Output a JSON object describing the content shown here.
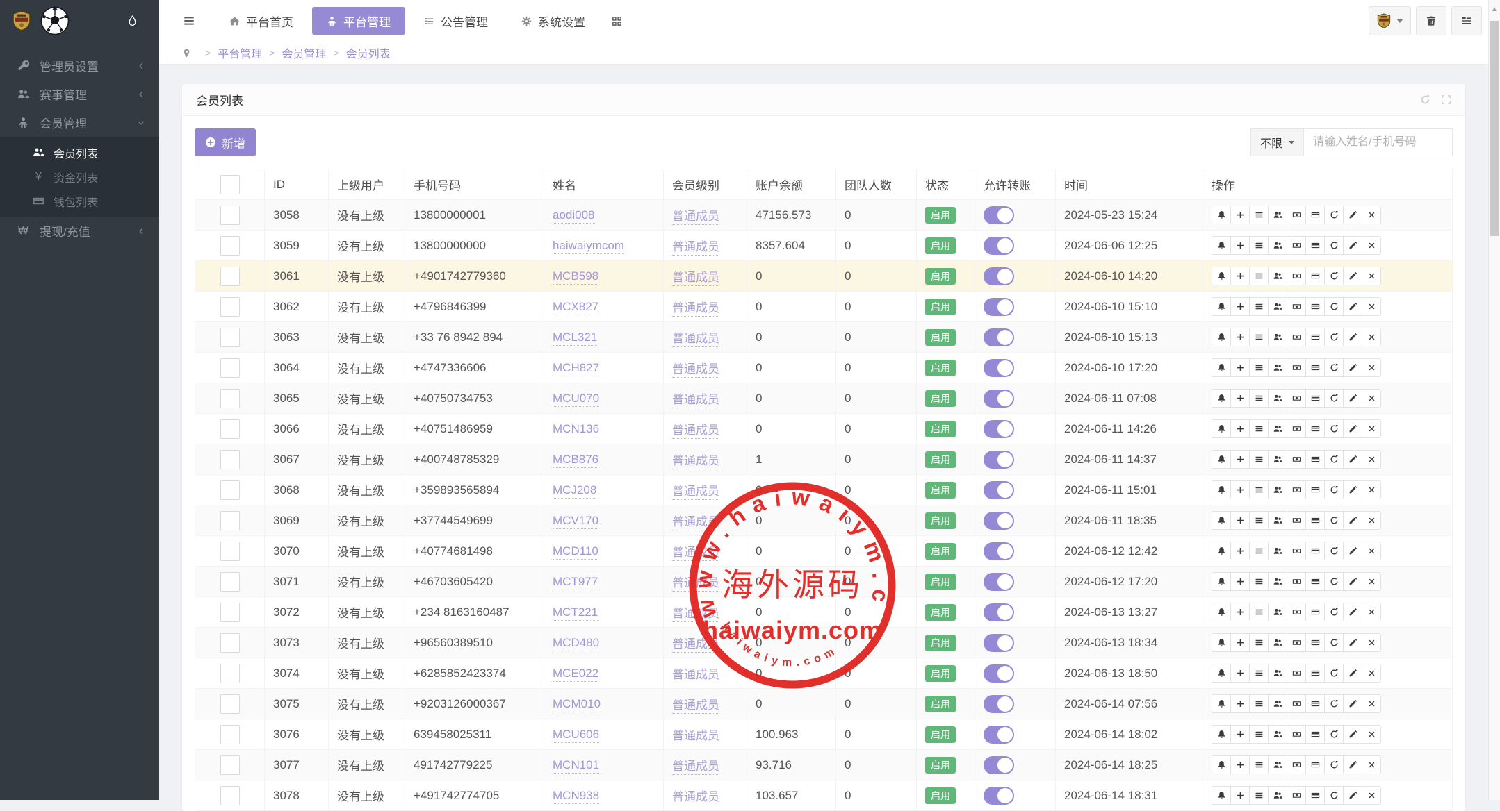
{
  "navbar": {
    "menu": [
      {
        "label": "平台首页",
        "icon": "i-home",
        "active": false
      },
      {
        "label": "平台管理",
        "icon": "i-person",
        "active": true
      },
      {
        "label": "公告管理",
        "icon": "i-list",
        "active": false
      },
      {
        "label": "系统设置",
        "icon": "i-gear",
        "active": false
      }
    ]
  },
  "sidebar": {
    "items": [
      {
        "label": "管理员设置",
        "icon": "i-key",
        "chevron": "left"
      },
      {
        "label": "赛事管理",
        "icon": "i-users",
        "chevron": "left"
      },
      {
        "label": "会员管理",
        "icon": "i-person",
        "chevron": "down",
        "open": true,
        "children": [
          {
            "label": "会员列表",
            "icon": "i-users",
            "active": true
          },
          {
            "label": "资金列表",
            "glyph": "¥"
          },
          {
            "label": "钱包列表",
            "icon": "i-card"
          }
        ]
      },
      {
        "label": "提现/充值",
        "glyph": "₩",
        "chevron": "left"
      }
    ]
  },
  "breadcrumb": {
    "sep": ">",
    "items": [
      "平台管理",
      "会员管理",
      "会员列表"
    ]
  },
  "card": {
    "title": "会员列表",
    "add_label": "新增",
    "filter_label": "不限",
    "search_placeholder": "请输入姓名/手机号码"
  },
  "table": {
    "headers": [
      "",
      "ID",
      "上级用户",
      "手机号码",
      "姓名",
      "会员级别",
      "账户余额",
      "团队人数",
      "状态",
      "允许转账",
      "时间",
      "操作"
    ],
    "status_label": "启用",
    "row_actions": [
      {
        "name": "bell-button",
        "icon": "i-bell"
      },
      {
        "name": "plus-button",
        "icon": "i-plus"
      },
      {
        "name": "detail-button",
        "icon": "i-bars"
      },
      {
        "name": "team-button",
        "icon": "i-users"
      },
      {
        "name": "money-button",
        "icon": "i-money"
      },
      {
        "name": "card-button",
        "icon": "i-card"
      },
      {
        "name": "refresh-button",
        "icon": "i-refresh"
      },
      {
        "name": "edit-button",
        "icon": "i-pencil"
      },
      {
        "name": "delete-button",
        "icon": "i-x"
      }
    ],
    "rows": [
      {
        "id": "3058",
        "parent": "没有上级",
        "phone": "13800000001",
        "name": "aodi008",
        "level": "普通成员",
        "balance": "47156.573",
        "team": "0",
        "time": "2024-05-23 15:24",
        "highlight": false
      },
      {
        "id": "3059",
        "parent": "没有上级",
        "phone": "13800000000",
        "name": "haiwaiymcom",
        "level": "普通成员",
        "balance": "8357.604",
        "team": "0",
        "time": "2024-06-06 12:25",
        "highlight": false
      },
      {
        "id": "3061",
        "parent": "没有上级",
        "phone": "+4901742779360",
        "name": "MCB598",
        "level": "普通成员",
        "balance": "0",
        "team": "0",
        "time": "2024-06-10 14:20",
        "highlight": true
      },
      {
        "id": "3062",
        "parent": "没有上级",
        "phone": "+4796846399",
        "name": "MCX827",
        "level": "普通成员",
        "balance": "0",
        "team": "0",
        "time": "2024-06-10 15:10",
        "highlight": false
      },
      {
        "id": "3063",
        "parent": "没有上级",
        "phone": "+33 76 8942 894",
        "name": "MCL321",
        "level": "普通成员",
        "balance": "0",
        "team": "0",
        "time": "2024-06-10 15:13",
        "highlight": false
      },
      {
        "id": "3064",
        "parent": "没有上级",
        "phone": "+4747336606",
        "name": "MCH827",
        "level": "普通成员",
        "balance": "0",
        "team": "0",
        "time": "2024-06-10 17:20",
        "highlight": false
      },
      {
        "id": "3065",
        "parent": "没有上级",
        "phone": "+40750734753",
        "name": "MCU070",
        "level": "普通成员",
        "balance": "0",
        "team": "0",
        "time": "2024-06-11 07:08",
        "highlight": false
      },
      {
        "id": "3066",
        "parent": "没有上级",
        "phone": "+40751486959",
        "name": "MCN136",
        "level": "普通成员",
        "balance": "0",
        "team": "0",
        "time": "2024-06-11 14:26",
        "highlight": false
      },
      {
        "id": "3067",
        "parent": "没有上级",
        "phone": "+400748785329",
        "name": "MCB876",
        "level": "普通成员",
        "balance": "1",
        "team": "0",
        "time": "2024-06-11 14:37",
        "highlight": false
      },
      {
        "id": "3068",
        "parent": "没有上级",
        "phone": "+359893565894",
        "name": "MCJ208",
        "level": "普通成员",
        "balance": "0",
        "team": "0",
        "time": "2024-06-11 15:01",
        "highlight": false
      },
      {
        "id": "3069",
        "parent": "没有上级",
        "phone": "+37744549699",
        "name": "MCV170",
        "level": "普通成员",
        "balance": "0",
        "team": "0",
        "time": "2024-06-11 18:35",
        "highlight": false
      },
      {
        "id": "3070",
        "parent": "没有上级",
        "phone": "+40774681498",
        "name": "MCD110",
        "level": "普通成员",
        "balance": "0",
        "team": "0",
        "time": "2024-06-12 12:42",
        "highlight": false
      },
      {
        "id": "3071",
        "parent": "没有上级",
        "phone": "+46703605420",
        "name": "MCT977",
        "level": "普通成员",
        "balance": "0",
        "team": "0",
        "time": "2024-06-12 17:20",
        "highlight": false
      },
      {
        "id": "3072",
        "parent": "没有上级",
        "phone": "+234 8163160487",
        "name": "MCT221",
        "level": "普通成员",
        "balance": "0",
        "team": "0",
        "time": "2024-06-13 13:27",
        "highlight": false
      },
      {
        "id": "3073",
        "parent": "没有上级",
        "phone": "+96560389510",
        "name": "MCD480",
        "level": "普通成员",
        "balance": "0",
        "team": "0",
        "time": "2024-06-13 18:34",
        "highlight": false
      },
      {
        "id": "3074",
        "parent": "没有上级",
        "phone": "+6285852423374",
        "name": "MCE022",
        "level": "普通成员",
        "balance": "0",
        "team": "0",
        "time": "2024-06-13 18:50",
        "highlight": false
      },
      {
        "id": "3075",
        "parent": "没有上级",
        "phone": "+9203126000367",
        "name": "MCM010",
        "level": "普通成员",
        "balance": "0",
        "team": "0",
        "time": "2024-06-14 07:56",
        "highlight": false
      },
      {
        "id": "3076",
        "parent": "没有上级",
        "phone": "639458025311",
        "name": "MCU606",
        "level": "普通成员",
        "balance": "100.963",
        "team": "0",
        "time": "2024-06-14 18:02",
        "highlight": false
      },
      {
        "id": "3077",
        "parent": "没有上级",
        "phone": "491742779225",
        "name": "MCN101",
        "level": "普通成员",
        "balance": "93.716",
        "team": "0",
        "time": "2024-06-14 18:25",
        "highlight": false
      },
      {
        "id": "3078",
        "parent": "没有上级",
        "phone": "+491742774705",
        "name": "MCN938",
        "level": "普通成员",
        "balance": "103.657",
        "team": "0",
        "time": "2024-06-14 18:31",
        "highlight": false
      }
    ]
  },
  "watermark": {
    "circle_text": "www.haiwaiym.com",
    "center_text": "海外源码",
    "domain_text": "haiwaiym.com",
    "bottom_text": "haiwaiym.com",
    "color": "#e02420"
  },
  "colors": {
    "accent": "#978ad5",
    "green": "#5FB878",
    "sidebar_bg": "#333a42",
    "highlight_row": "#fcf7e2"
  }
}
